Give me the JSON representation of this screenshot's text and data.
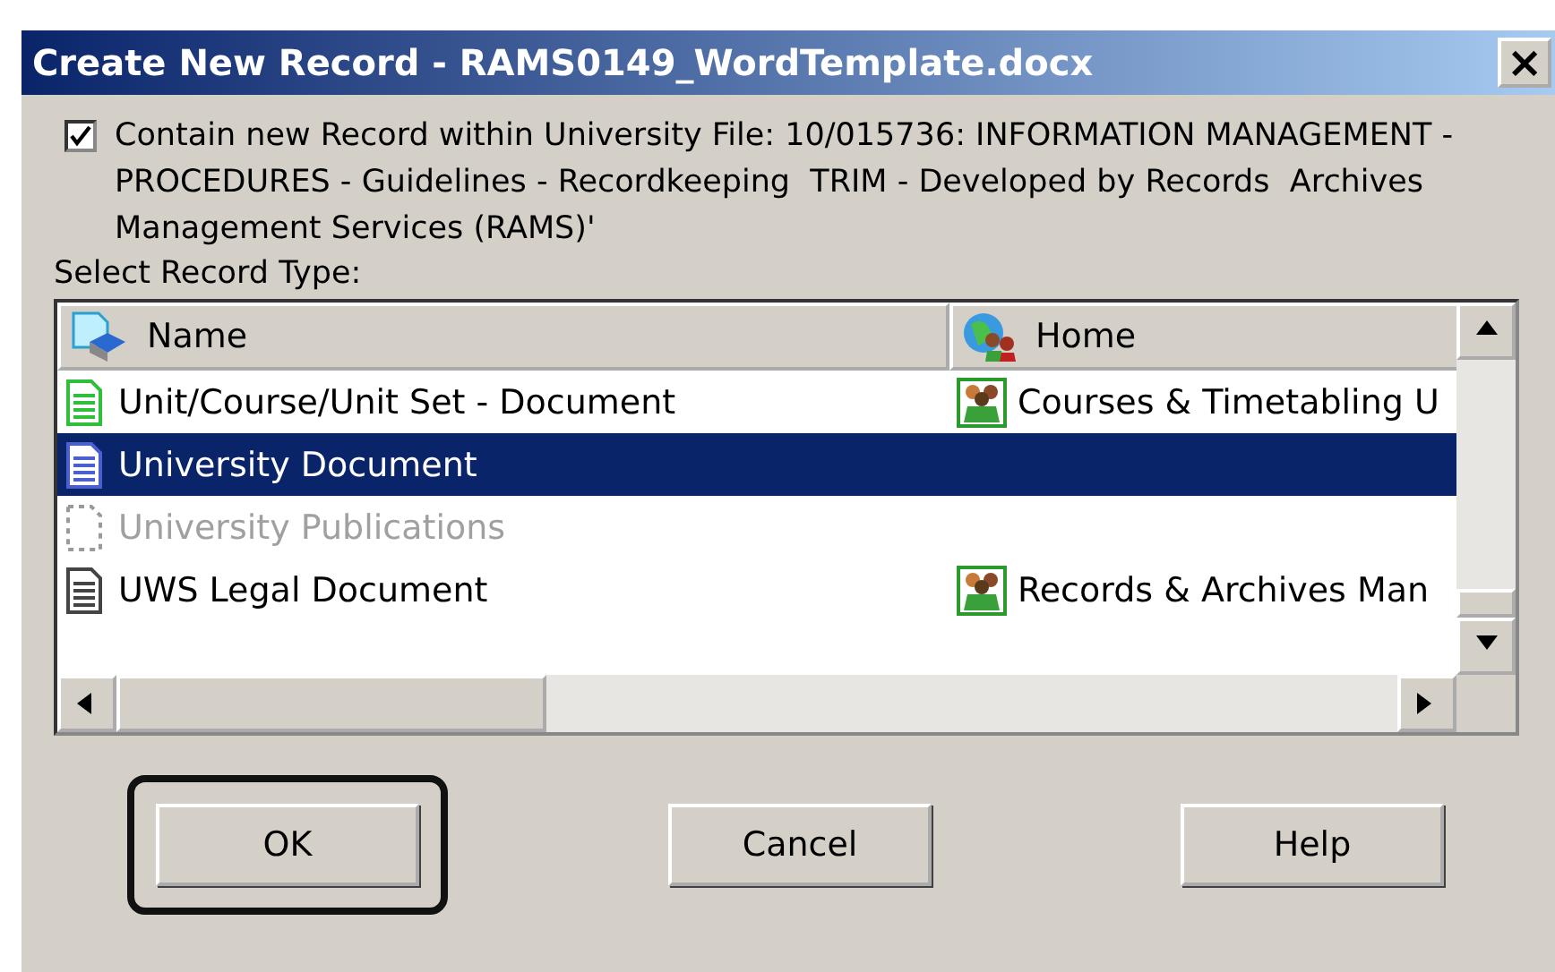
{
  "window": {
    "title": "Create New Record - RAMS0149_WordTemplate.docx",
    "close": "×"
  },
  "contain": {
    "checked": true,
    "label": "Contain new Record within University File: 10/015736: INFORMATION MANAGEMENT - PROCEDURES - Guidelines - Recordkeeping  TRIM - Developed by Records  Archives Management Services (RAMS)'"
  },
  "list_label": "Select Record Type:",
  "table": {
    "columns": [
      "Name",
      "Home"
    ],
    "rows": [
      {
        "name": "Unit/Course/Unit Set - Document",
        "home": "Courses & Timetabling U",
        "color": "#2fbf3a",
        "selected": false,
        "disabled": false
      },
      {
        "name": "University Document",
        "color": "#4a5fd0",
        "selected": true,
        "disabled": false
      },
      {
        "name": "University Publications",
        "color": "#9a9a9a",
        "selected": false,
        "disabled": true
      },
      {
        "name": "UWS Legal Document",
        "home": "Records & Archives Man",
        "color": "#444444",
        "selected": false,
        "disabled": false
      }
    ]
  },
  "buttons": [
    {
      "label": "OK",
      "highlighted": true
    },
    {
      "label": "Cancel",
      "highlighted": false
    },
    {
      "label": "Help",
      "highlighted": false
    }
  ]
}
